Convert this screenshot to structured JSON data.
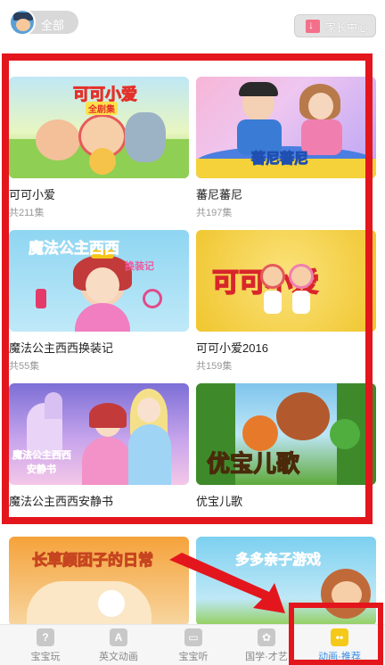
{
  "header": {
    "filter_label": "全部",
    "parent_center_label": "家长中心"
  },
  "videos": [
    {
      "title": "可可小爱",
      "count": "共211集",
      "logo": "可可小爱",
      "logo_sub": "全剧集"
    },
    {
      "title": "蕃尼蕃尼",
      "count": "共197集",
      "logo": "蕃尼蕃尼"
    },
    {
      "title": "魔法公主西西换装记",
      "count": "共55集",
      "logo": "魔法公主西西",
      "logo_sub": "换装记"
    },
    {
      "title": "可可小爱2016",
      "count": "共159集",
      "logo": "可可小爱"
    },
    {
      "title": "魔法公主西西安静书",
      "count": "",
      "logo": "魔法公主西西",
      "logo_sub": "安静书"
    },
    {
      "title": "优宝儿歌",
      "count": "",
      "logo": "优宝儿歌"
    }
  ],
  "more_row": [
    {
      "logo": "长草颜团子的日常"
    },
    {
      "logo": "多多亲子游戏"
    }
  ],
  "tabs": [
    {
      "label": "宝宝玩",
      "icon": "calendar-icon",
      "glyph": "?"
    },
    {
      "label": "英文动画",
      "icon": "letter-a-icon",
      "glyph": "A"
    },
    {
      "label": "宝宝听",
      "icon": "radio-icon",
      "glyph": "▭"
    },
    {
      "label": "国学·才艺",
      "icon": "paw-icon",
      "glyph": "✿"
    },
    {
      "label": "动画·推荐",
      "icon": "tv-icon",
      "glyph": "••"
    }
  ],
  "colors": {
    "highlight": "#e4161d",
    "active_tab_text": "#3a8ee6",
    "active_tab_icon": "#f5c918"
  }
}
